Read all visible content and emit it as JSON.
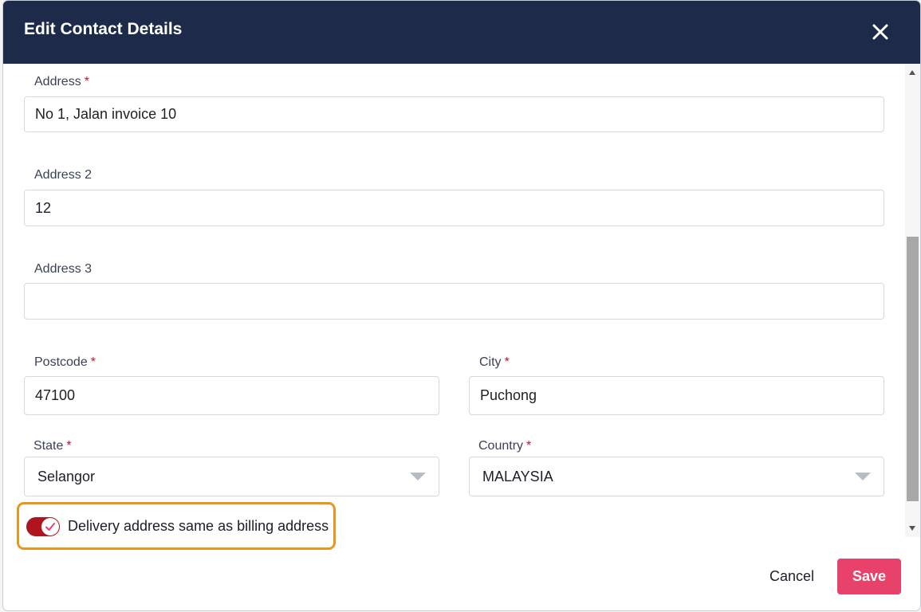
{
  "dialog": {
    "title": "Edit Contact Details",
    "close_icon": "close-icon"
  },
  "form": {
    "address": {
      "label": "Address",
      "required_mark": "*",
      "value": "No 1, Jalan invoice 10"
    },
    "address2": {
      "label": "Address 2",
      "value": "12"
    },
    "address3": {
      "label": "Address 3",
      "value": ""
    },
    "postcode": {
      "label": "Postcode",
      "required_mark": "*",
      "value": "47100"
    },
    "city": {
      "label": "City",
      "required_mark": "*",
      "value": "Puchong"
    },
    "state": {
      "label": "State",
      "required_mark": "*",
      "value": "Selangor"
    },
    "country": {
      "label": "Country",
      "required_mark": "*",
      "value": "MALAYSIA"
    },
    "delivery_same": {
      "label": "Delivery address same as billing address",
      "checked": true
    }
  },
  "footer": {
    "cancel_label": "Cancel",
    "save_label": "Save"
  },
  "colors": {
    "header_bg": "#1e2a4a",
    "save_bg": "#e8426b",
    "toggle_on": "#b0141f",
    "highlight_border": "#e8961c",
    "required": "#c8102e"
  }
}
